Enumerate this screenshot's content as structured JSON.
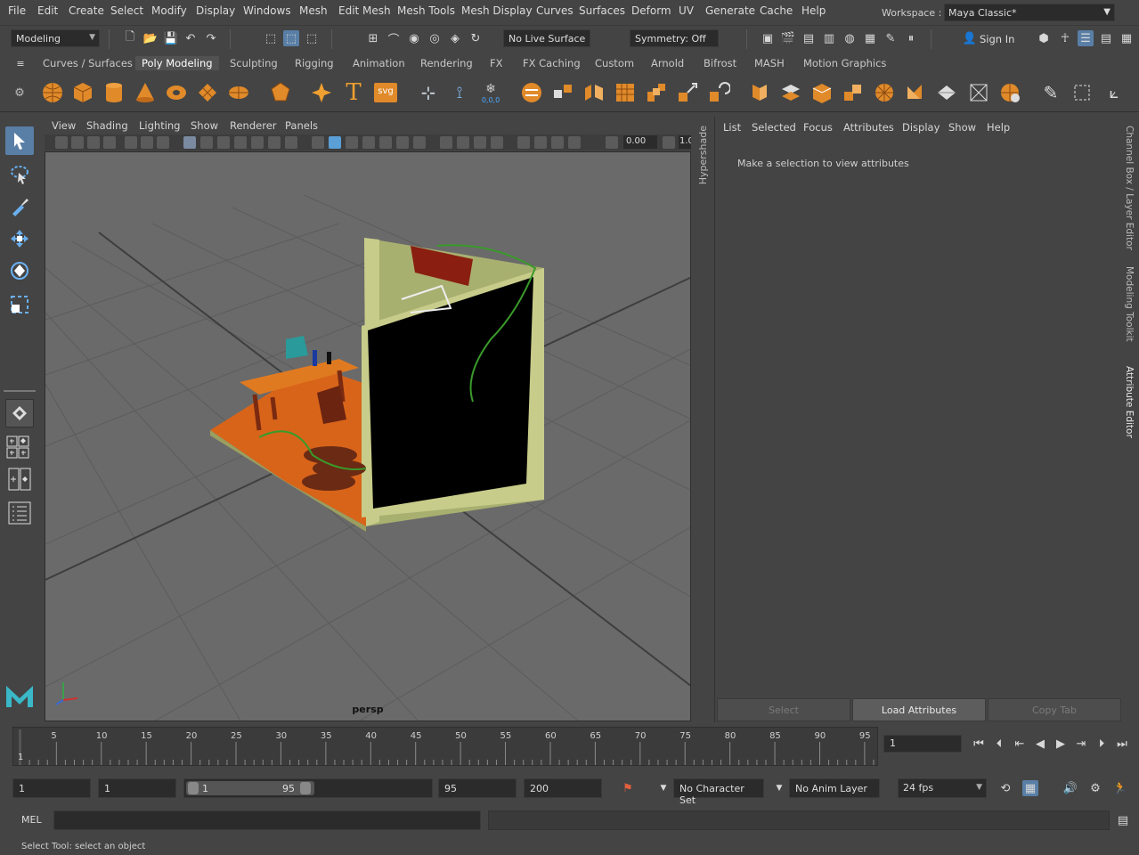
{
  "menubar": {
    "items": [
      "File",
      "Edit",
      "Create",
      "Select",
      "Modify",
      "Display",
      "Windows",
      "Mesh",
      "Edit Mesh",
      "Mesh Tools",
      "Mesh Display",
      "Curves",
      "Surfaces",
      "Deform",
      "UV",
      "Generate",
      "Cache",
      "Help"
    ],
    "workspace_label": "Workspace :",
    "workspace_value": "Maya Classic*"
  },
  "statusline": {
    "mode": "Modeling",
    "live_surface": "No Live Surface",
    "symmetry": "Symmetry: Off",
    "sign_in": "Sign In"
  },
  "shelf": {
    "tabs": [
      "Curves / Surfaces",
      "Poly Modeling",
      "Sculpting",
      "Rigging",
      "Animation",
      "Rendering",
      "FX",
      "FX Caching",
      "Custom",
      "Arnold",
      "Bifrost",
      "MASH",
      "Motion Graphics"
    ],
    "active_tab": "Poly Modeling",
    "text_icon_label": "T",
    "svg_icon_label": "svg",
    "coords_label": "0,0,0"
  },
  "viewport": {
    "menu": [
      "View",
      "Shading",
      "Lighting",
      "Show",
      "Renderer",
      "Panels"
    ],
    "value_field": "0.00",
    "value_field2": "1.0",
    "camera_label": "persp"
  },
  "side_panel": {
    "hypershade_label": "Hypershade"
  },
  "attribute_editor": {
    "menu": [
      "List",
      "Selected",
      "Focus",
      "Attributes",
      "Display",
      "Show",
      "Help"
    ],
    "message": "Make a selection to view attributes",
    "buttons": [
      "Select",
      "Load Attributes",
      "Copy Tab"
    ]
  },
  "right_tabs": [
    "Channel Box / Layer Editor",
    "Modeling Toolkit",
    "Attribute Editor"
  ],
  "timeline": {
    "ticks": [
      5,
      10,
      15,
      20,
      25,
      30,
      35,
      40,
      45,
      50,
      55,
      60,
      65,
      70,
      75,
      80,
      85,
      90,
      95
    ],
    "current_frame_marker": "1",
    "current_frame_field": "1"
  },
  "range_slider": {
    "start_field": "1",
    "playback_start": "1",
    "slider_start": "1",
    "slider_end": "95",
    "playback_end": "95",
    "end_field": "200",
    "character_set": "No Character Set",
    "anim_layer": "No Anim Layer",
    "fps": "24 fps"
  },
  "command_line": {
    "label": "MEL"
  },
  "help_line": {
    "text": "Select Tool: select an object"
  }
}
